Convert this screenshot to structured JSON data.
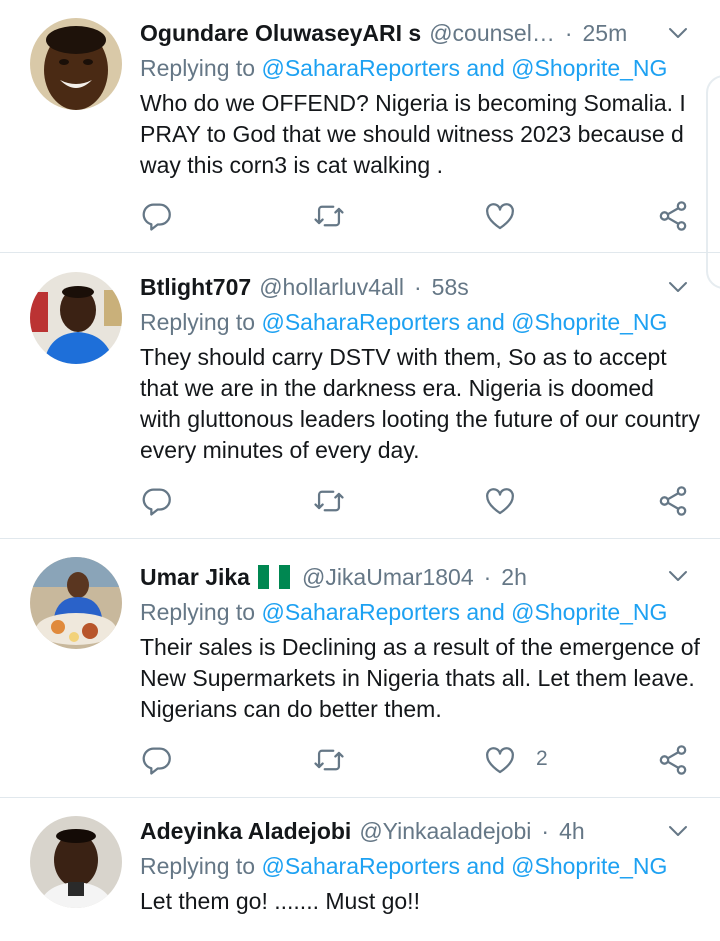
{
  "replying_label": "Replying to",
  "mention_1": "@SaharaReporters",
  "and_label": "and",
  "mention_2": "@Shoprite_NG",
  "tweets": [
    {
      "name": "Ogundare OluwaseyARI s",
      "handle": "@counsel…",
      "time": "25m",
      "text": "Who do we OFFEND? Nigeria is becoming Somalia. I PRAY to God that we should witness 2023 because d way this corn3 is cat walking .",
      "likes": ""
    },
    {
      "name": "Btlight707",
      "handle": "@hollarluv4all",
      "time": "58s",
      "text": "They should carry DSTV with them, So as to accept that we are in the darkness era. Nigeria is doomed with gluttonous leaders looting the future of our country every minutes of every day.",
      "likes": ""
    },
    {
      "name": "Umar Jika",
      "handle": "@JikaUmar1804",
      "time": "2h",
      "text": "Their sales is Declining as a result of the emergence of New Supermarkets in Nigeria thats all. Let them leave. Nigerians can do better them.",
      "likes": "2"
    },
    {
      "name": "Adeyinka Aladejobi",
      "handle": "@Yinkaaladejobi",
      "time": "4h",
      "text": "Let them go! ....... Must go!!",
      "likes": ""
    }
  ],
  "colors": {
    "link": "#1da1f2",
    "secondary_text": "#657786",
    "primary_text": "#14171a",
    "divider": "#e1e8ed",
    "flag_green": "#008751"
  },
  "icons": [
    "reply-icon",
    "retweet-icon",
    "like-icon",
    "share-icon",
    "chevron-down-icon",
    "nigeria-flag-icon"
  ]
}
